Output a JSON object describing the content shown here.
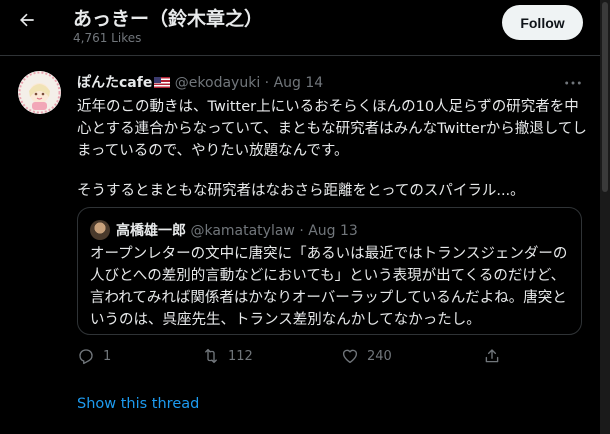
{
  "header": {
    "title": "あっきー（鈴木章之）",
    "likes": "4,761 Likes",
    "follow_label": "Follow",
    "back_icon": "arrow-left-icon"
  },
  "tweet": {
    "author_name": "ぽんたcafe",
    "flag_icon": "us-flag-icon",
    "handle": "@ekodayuki",
    "separator": "·",
    "date": "Aug 14",
    "more_icon": "more-horizontal-icon",
    "paragraphs": [
      "近年のこの動きは、Twitter上にいるおそらくほんの10人足らずの研究者を中心とする連合からなっていて、まともな研究者はみんなTwitterから撤退してしまっているので、やりたい放題なんです。",
      "そうするとまともな研究者はなおさら距離をとってのスパイラル...。"
    ],
    "quote": {
      "author_name": "高橋雄一郎",
      "handle": "@kamatatylaw",
      "separator": "·",
      "date": "Aug 13",
      "text": "オープンレターの文中に唐突に「あるいは最近ではトランスジェンダーの人びとへの差別的言動などにおいても」という表現が出てくるのだけど、言われてみれば関係者はかなりオーバーラップしているんだよね。唐突というのは、呉座先生、トランス差別なんかしてなかったし。"
    },
    "actions": {
      "reply_count": "1",
      "retweet_count": "112",
      "like_count": "240"
    }
  },
  "show_thread_label": "Show this thread",
  "colors": {
    "background": "#000000",
    "text": "#e7e9ea",
    "muted": "#71767b",
    "link": "#1d9bf0",
    "border": "#2f3336",
    "follow_bg": "#eff3f4"
  }
}
